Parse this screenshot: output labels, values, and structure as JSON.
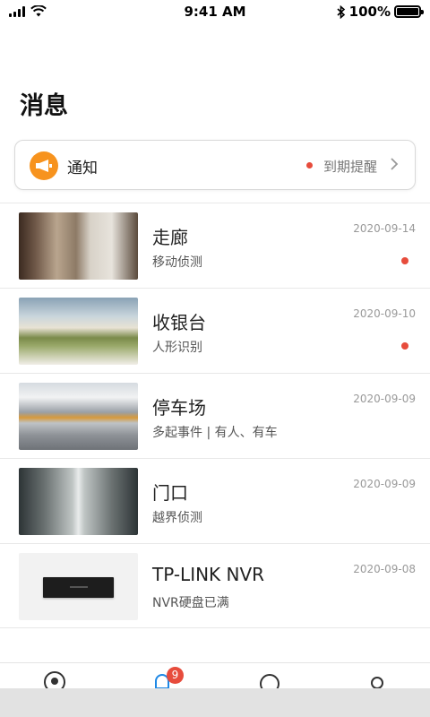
{
  "status_bar": {
    "time": "9:41 AM",
    "battery_text": "100%",
    "icons": [
      "signal-icon",
      "wifi-icon",
      "bluetooth-icon",
      "battery-icon"
    ]
  },
  "page": {
    "title": "消息"
  },
  "notice": {
    "label": "通知",
    "status": "到期提醒",
    "icon": "megaphone-icon",
    "accent_color": "#f7931e"
  },
  "messages": [
    {
      "title": "走廊",
      "subtitle": "移动侦测",
      "date": "2020-09-14",
      "unread": true,
      "thumbnail": "corridor"
    },
    {
      "title": "收银台",
      "subtitle": "人形识别",
      "date": "2020-09-10",
      "unread": true,
      "thumbnail": "cashier"
    },
    {
      "title": "停车场",
      "subtitle": "多起事件 | 有人、有车",
      "date": "2020-09-09",
      "unread": false,
      "thumbnail": "parking"
    },
    {
      "title": "门口",
      "subtitle": "越界侦测",
      "date": "2020-09-09",
      "unread": false,
      "thumbnail": "doorway"
    },
    {
      "title": "TP-LINK NVR",
      "subtitle": "NVR硬盘已满",
      "date": "2020-09-08",
      "unread": false,
      "thumbnail": "nvr-device"
    }
  ],
  "bottom_nav": {
    "items": [
      "camera-tab-icon",
      "message-tab-icon",
      "cloud-tab-icon",
      "profile-tab-icon"
    ],
    "badge_count": "9"
  },
  "colors": {
    "unread_dot": "#e74c3c",
    "badge": "#e74c3c",
    "active_tab": "#1e88e5"
  }
}
